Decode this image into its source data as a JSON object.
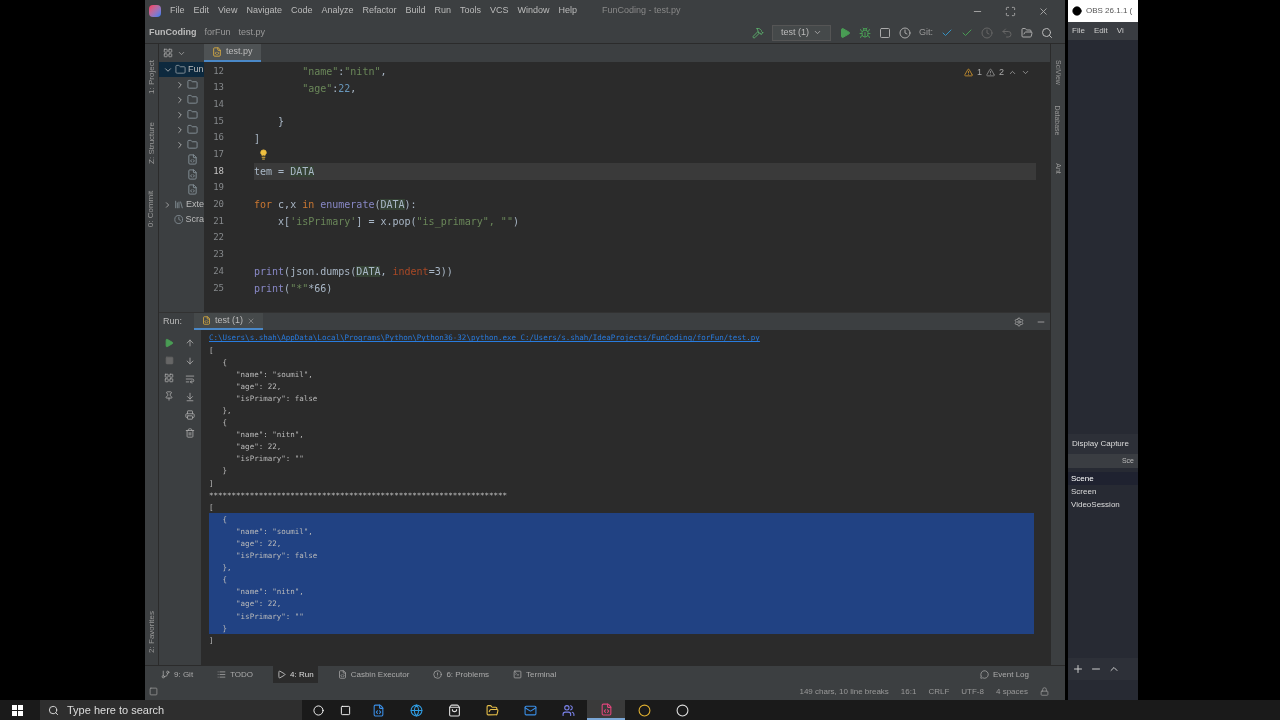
{
  "ide": {
    "menu": [
      "File",
      "Edit",
      "View",
      "Navigate",
      "Code",
      "Analyze",
      "Refactor",
      "Build",
      "Run",
      "Tools",
      "VCS",
      "Window",
      "Help"
    ],
    "window_title": "FunCoding - test.py",
    "breadcrumb": [
      "FunCoding",
      "forFun",
      "test.py"
    ],
    "run_config": "test (1)",
    "git_label": "Git:",
    "left_stripe": [
      "1: Project",
      "Z: Structure",
      "0: Commit"
    ],
    "left_stripe_bottom": [
      "2: Favorites"
    ],
    "right_stripe": [
      "SciView",
      "Database",
      "Ant"
    ],
    "project_tree": [
      {
        "label": "Fun",
        "kind": "module",
        "expanded": true,
        "selected": true,
        "children": [
          {
            "kind": "folder",
            "expanded": false
          },
          {
            "kind": "folder",
            "expanded": false
          },
          {
            "kind": "folder",
            "expanded": false
          },
          {
            "kind": "folder",
            "expanded": false
          },
          {
            "kind": "folder",
            "expanded": false
          },
          {
            "kind": "file"
          },
          {
            "kind": "file"
          },
          {
            "kind": "file"
          }
        ]
      },
      {
        "label": "Exte",
        "kind": "library",
        "expanded": false,
        "selected": false
      },
      {
        "label": "Scra",
        "kind": "scratch",
        "selected": false
      }
    ],
    "editor_tabs": [
      {
        "label": "test.py",
        "selected": true
      }
    ],
    "inspections": {
      "warnings": "1",
      "weak_warnings": "2"
    },
    "code": [
      {
        "number": "12",
        "current": false,
        "bulb": false,
        "tokens": [
          {
            "text": "        \"name\"",
            "kind": "string"
          },
          {
            "text": ":",
            "kind": "plain"
          },
          {
            "text": "\"nitn\"",
            "kind": "string"
          },
          {
            "text": ",",
            "kind": "plain"
          }
        ]
      },
      {
        "number": "13",
        "current": false,
        "bulb": false,
        "tokens": [
          {
            "text": "        \"age\"",
            "kind": "string"
          },
          {
            "text": ":",
            "kind": "plain"
          },
          {
            "text": "22",
            "kind": "number"
          },
          {
            "text": ",",
            "kind": "plain"
          }
        ]
      },
      {
        "number": "14",
        "current": false,
        "bulb": false
      },
      {
        "number": "15",
        "current": false,
        "bulb": false,
        "tokens": [
          {
            "text": "    }",
            "kind": "plain"
          }
        ]
      },
      {
        "number": "16",
        "current": false,
        "bulb": false,
        "tokens": [
          {
            "text": "]",
            "kind": "plain"
          }
        ]
      },
      {
        "number": "17",
        "current": false,
        "bulb": true
      },
      {
        "number": "18",
        "current": true,
        "bulb": false,
        "tokens": [
          {
            "text": "tem = ",
            "kind": "plain"
          },
          {
            "text": "DATA",
            "kind": "ref"
          }
        ]
      },
      {
        "number": "19",
        "current": false,
        "bulb": false
      },
      {
        "number": "20",
        "current": false,
        "bulb": false,
        "tokens": [
          {
            "text": "for ",
            "kind": "keyword"
          },
          {
            "text": "c,x ",
            "kind": "plain"
          },
          {
            "text": "in ",
            "kind": "keyword"
          },
          {
            "text": "enumerate",
            "kind": "builtin"
          },
          {
            "text": "(",
            "kind": "plain"
          },
          {
            "text": "DATA",
            "kind": "ref"
          },
          {
            "text": "):",
            "kind": "plain"
          }
        ]
      },
      {
        "number": "21",
        "current": false,
        "bulb": false,
        "tokens": [
          {
            "text": "    x[",
            "kind": "plain"
          },
          {
            "text": "'isPrimary'",
            "kind": "string"
          },
          {
            "text": "] = x.pop(",
            "kind": "plain"
          },
          {
            "text": "\"is_primary\", \"\"",
            "kind": "string"
          },
          {
            "text": ")",
            "kind": "plain"
          }
        ]
      },
      {
        "number": "22",
        "current": false,
        "bulb": false
      },
      {
        "number": "23",
        "current": false,
        "bulb": false
      },
      {
        "number": "24",
        "current": false,
        "bulb": false,
        "tokens": [
          {
            "text": "print",
            "kind": "builtin"
          },
          {
            "text": "(json.dumps(",
            "kind": "plain"
          },
          {
            "text": "DATA",
            "kind": "ref"
          },
          {
            "text": ", ",
            "kind": "plain"
          },
          {
            "text": "indent",
            "kind": "param"
          },
          {
            "text": "=3))",
            "kind": "plain"
          }
        ]
      },
      {
        "number": "25",
        "current": false,
        "bulb": false,
        "tokens": [
          {
            "text": "print",
            "kind": "builtin"
          },
          {
            "text": "(",
            "kind": "plain"
          },
          {
            "text": "\"*\"",
            "kind": "string"
          },
          {
            "text": "*66)",
            "kind": "plain"
          }
        ]
      }
    ],
    "run_panel": {
      "label": "Run:",
      "tab": "test (1)",
      "console": [
        {
          "text": "C:\\Users\\s.shah\\AppData\\Local\\Programs\\Python\\Python36-32\\python.exe C:/Users/s.shah/IdeaProjects/FunCoding/forFun/test.py",
          "kind": "command",
          "selected": false
        },
        {
          "text": "[",
          "kind": "output",
          "selected": false
        },
        {
          "text": "   {",
          "kind": "output",
          "selected": false
        },
        {
          "text": "      \"name\": \"soumil\",",
          "kind": "output",
          "selected": false
        },
        {
          "text": "      \"age\": 22,",
          "kind": "output",
          "selected": false
        },
        {
          "text": "      \"isPrimary\": false",
          "kind": "output",
          "selected": false
        },
        {
          "text": "   },",
          "kind": "output",
          "selected": false
        },
        {
          "text": "   {",
          "kind": "output",
          "selected": false
        },
        {
          "text": "      \"name\": \"nitn\",",
          "kind": "output",
          "selected": false
        },
        {
          "text": "      \"age\": 22,",
          "kind": "output",
          "selected": false
        },
        {
          "text": "      \"isPrimary\": \"\"",
          "kind": "output",
          "selected": false
        },
        {
          "text": "   }",
          "kind": "output",
          "selected": false
        },
        {
          "text": "]",
          "kind": "output",
          "selected": false
        },
        {
          "text": "******************************************************************",
          "kind": "output",
          "selected": false
        },
        {
          "text": "[",
          "kind": "output",
          "selected": false
        },
        {
          "text": "   {",
          "kind": "output",
          "selected": true
        },
        {
          "text": "      \"name\": \"soumil\",",
          "kind": "output",
          "selected": true
        },
        {
          "text": "      \"age\": 22,",
          "kind": "output",
          "selected": true
        },
        {
          "text": "      \"isPrimary\": false",
          "kind": "output",
          "selected": true
        },
        {
          "text": "   },",
          "kind": "output",
          "selected": true
        },
        {
          "text": "   {",
          "kind": "output",
          "selected": true
        },
        {
          "text": "      \"name\": \"nitn\",",
          "kind": "output",
          "selected": true
        },
        {
          "text": "      \"age\": 22,",
          "kind": "output",
          "selected": true
        },
        {
          "text": "      \"isPrimary\": \"\"",
          "kind": "output",
          "selected": true
        },
        {
          "text": "   }",
          "kind": "output",
          "selected": true
        },
        {
          "text": "]",
          "kind": "output",
          "selected": false
        }
      ]
    },
    "tool_tabs": [
      {
        "label": "9: Git",
        "kind": "git",
        "selected": false
      },
      {
        "label": "TODO",
        "kind": "todo",
        "selected": false
      },
      {
        "label": "4: Run",
        "kind": "run",
        "selected": true
      },
      {
        "label": "Casbin Executor",
        "kind": "casbin",
        "selected": false
      },
      {
        "label": "6: Problems",
        "kind": "problems",
        "selected": false
      },
      {
        "label": "Terminal",
        "kind": "terminal",
        "selected": false
      }
    ],
    "event_log": "Event Log",
    "status": [
      "149 chars, 10 line breaks",
      "16:1",
      "CRLF",
      "UTF-8",
      "4 spaces"
    ]
  },
  "obs": {
    "title": "OBS 26.1.1 (",
    "menu": [
      "File",
      "Edit",
      "Vi"
    ],
    "source": "Display Capture",
    "scenes_header": "Sce",
    "scenes": [
      {
        "label": "Scene",
        "selected": true
      },
      {
        "label": "Screen",
        "selected": false
      },
      {
        "label": "VideoSession",
        "selected": false
      }
    ]
  },
  "taskbar": {
    "search": {
      "placeholder": "Type here to search"
    },
    "apps": [
      {
        "kind": "app",
        "active": false
      },
      {
        "kind": "edge",
        "active": false
      },
      {
        "kind": "store",
        "active": false
      },
      {
        "kind": "explorer",
        "active": false
      },
      {
        "kind": "mail",
        "active": false
      },
      {
        "kind": "teams",
        "active": false
      },
      {
        "kind": "intellij",
        "active": true
      },
      {
        "kind": "chrome",
        "active": false
      },
      {
        "kind": "obs",
        "active": false
      }
    ]
  }
}
